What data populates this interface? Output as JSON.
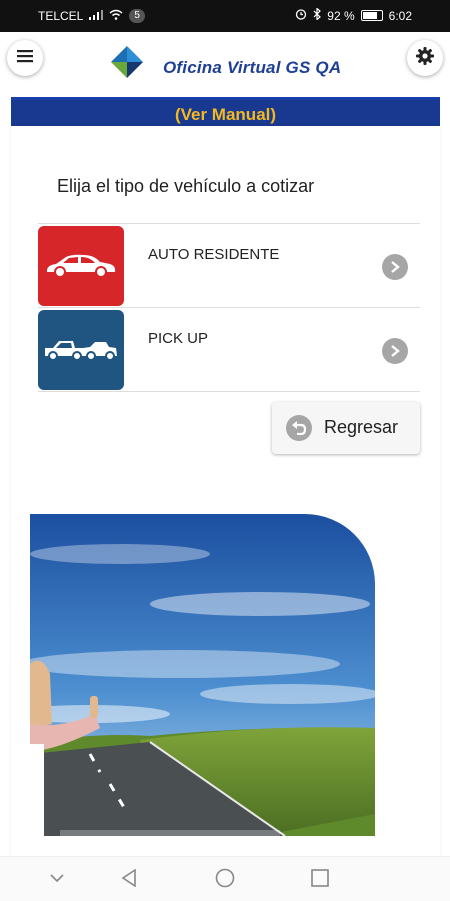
{
  "status_bar": {
    "carrier": "TELCEL",
    "badge": "5",
    "battery": "92 %",
    "battery_level": 0.92,
    "time": "6:02"
  },
  "app_bar": {
    "title": "Oficina Virtual GS QA",
    "menu_icon": "menu-icon",
    "settings_icon": "gear-icon"
  },
  "banner": {
    "link_label": "(Ver Manual)"
  },
  "main": {
    "heading": "Elija el tipo de vehículo a cotizar",
    "options": [
      {
        "label": "AUTO RESIDENTE",
        "icon": "car-icon",
        "color": "#d6262a"
      },
      {
        "label": "PICK UP",
        "icon": "pickup-truck-icon",
        "color": "#1f5580"
      }
    ],
    "back_button": {
      "label": "Regresar",
      "icon": "undo-icon"
    }
  },
  "promo": {
    "image": "promo-banner-image"
  },
  "nav": {
    "icons": [
      "chevron-down-icon",
      "back-triangle-icon",
      "home-circle-icon",
      "recents-square-icon"
    ]
  },
  "colors": {
    "brand_blue": "#1d3f95",
    "banner_blue": "#18398f",
    "banner_text": "#f6b81f"
  }
}
